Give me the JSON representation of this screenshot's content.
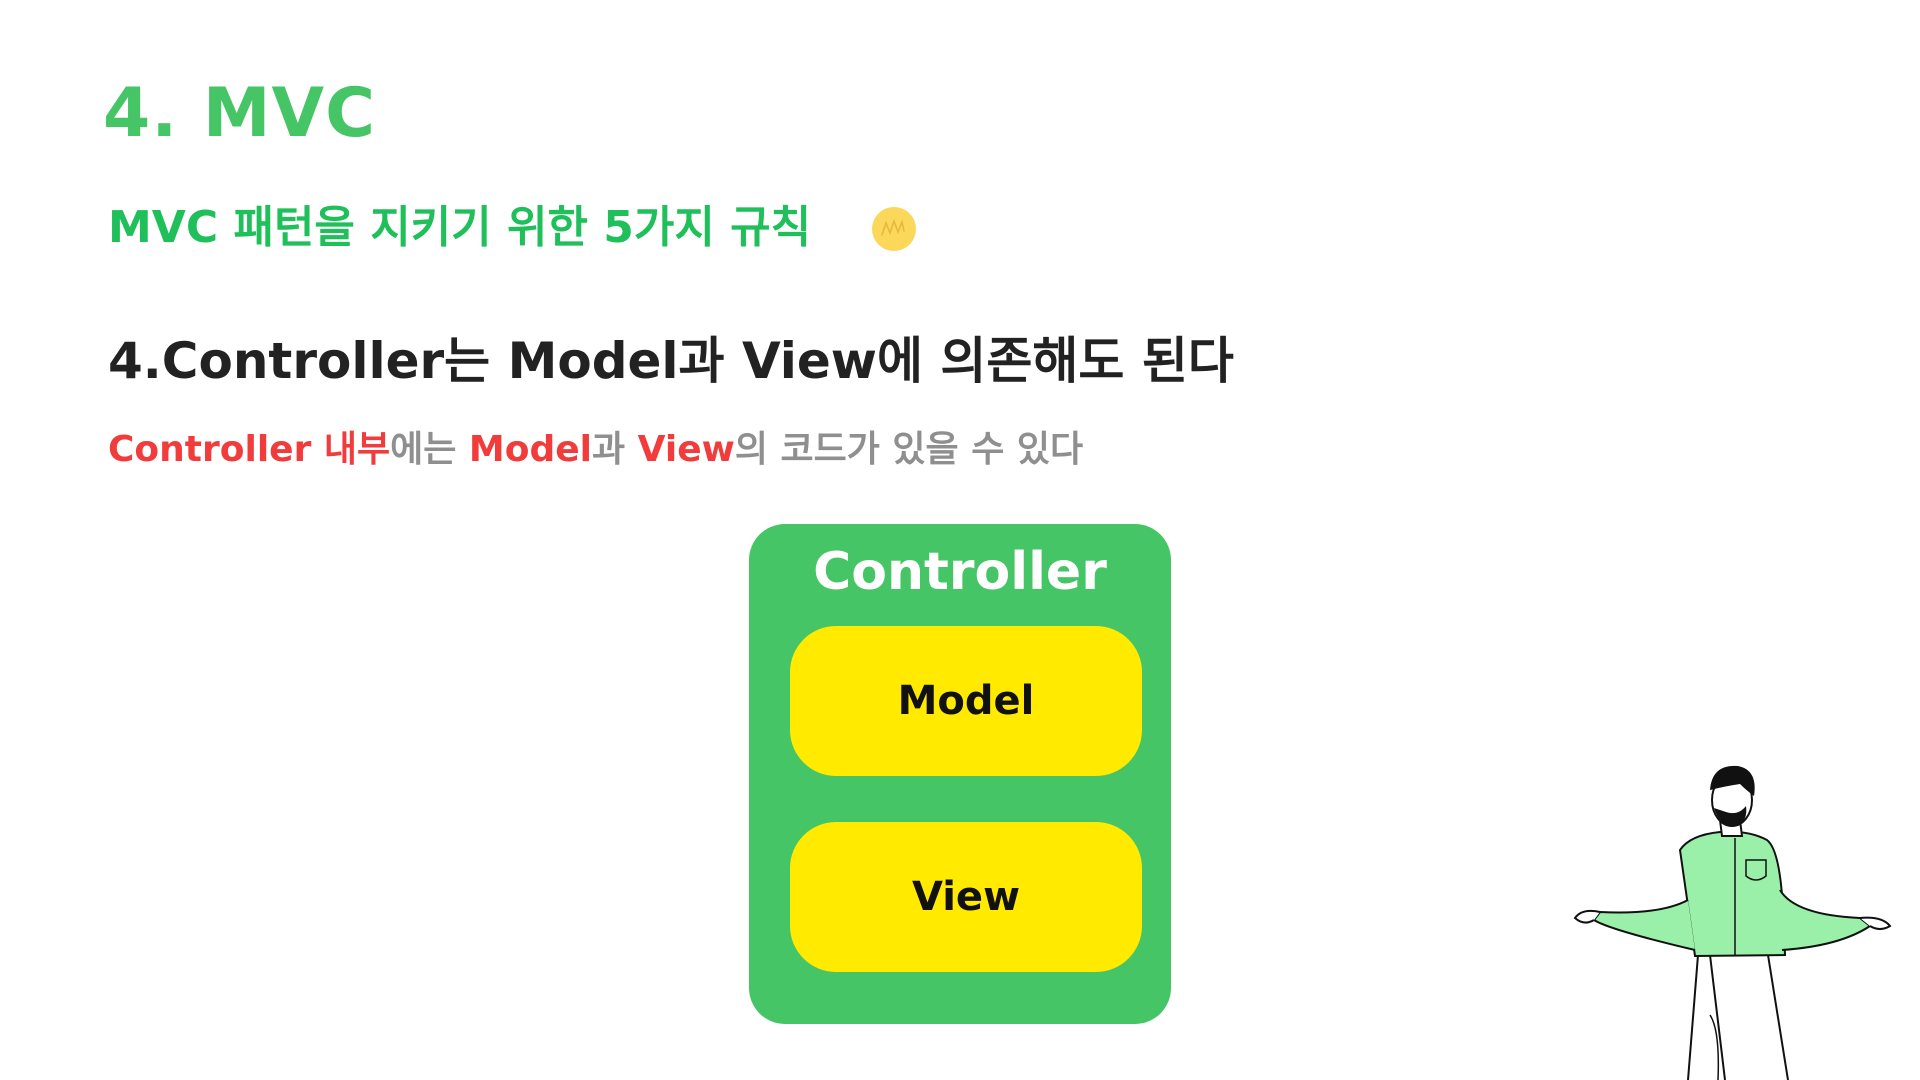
{
  "slide": {
    "title": "4. MVC",
    "subtitle": "MVC 패턴을 지키기 위한 5가지 규칙",
    "rule_heading": "4.Controller는 Model과 View에 의존해도 된다",
    "description_parts": {
      "p1": "Controller 내부",
      "p2": "에는 ",
      "p3": "Model",
      "p4": "과 ",
      "p5": "View",
      "p6": "의 코드가 있을 수 있다"
    }
  },
  "diagram": {
    "outer_label": "Controller",
    "inner_top": "Model",
    "inner_bottom": "View"
  },
  "icons": {
    "subtitle_decoration": "sun-doodle-icon",
    "illustration": "shrugging-person-illustration"
  },
  "colors": {
    "title_green": "#45c565",
    "subtitle_green": "#1fbf5a",
    "controller_green": "#45c565",
    "inner_yellow": "#ffea00",
    "highlight_red": "#f23b3b",
    "sun_yellow": "#fbd85a",
    "shirt_green": "#9af0a8"
  }
}
